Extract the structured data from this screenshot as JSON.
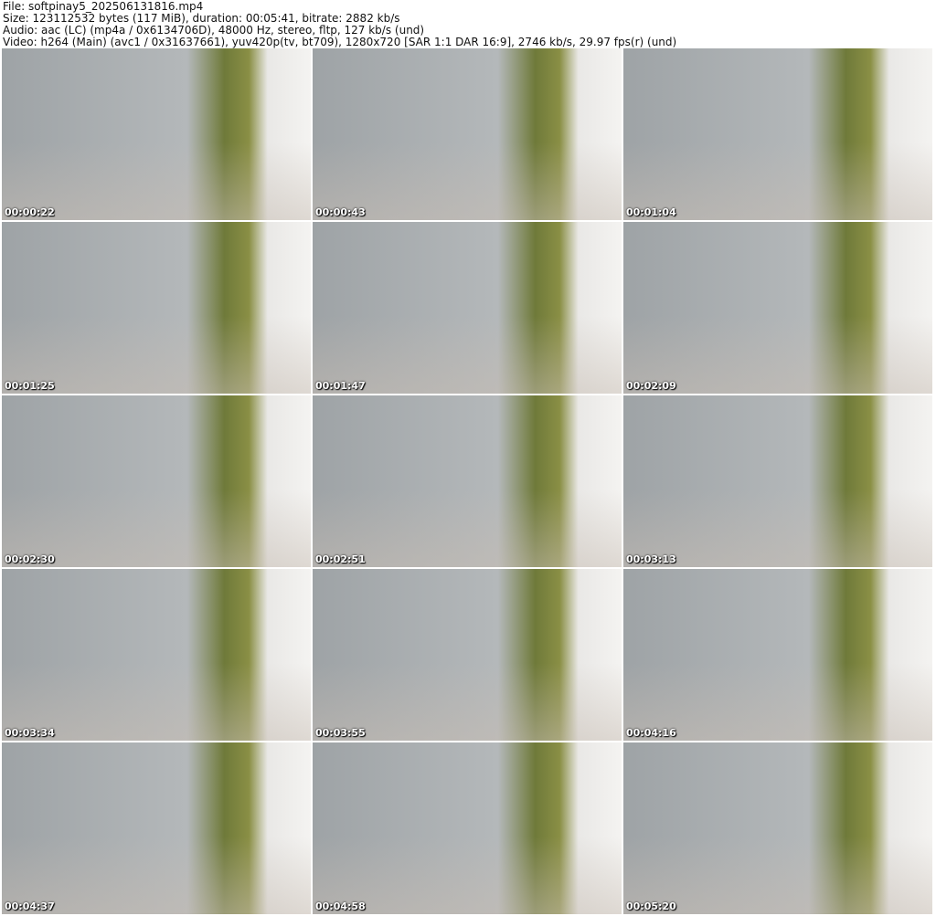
{
  "header": {
    "file": "File: softpinay5_202506131816.mp4",
    "size": "Size: 123112532 bytes (117 MiB), duration: 00:05:41, bitrate: 2882 kb/s",
    "audio": "Audio: aac (LC) (mp4a / 0x6134706D), 48000 Hz, stereo, fltp, 127 kb/s (und)",
    "video": "Video: h264 (Main) (avc1 / 0x31637661), yuv420p(tv, bt709), 1280x720 [SAR 1:1 DAR 16:9], 2746 kb/s, 29.97 fps(r) (und)"
  },
  "frames": [
    {
      "timestamp": "00:00:22"
    },
    {
      "timestamp": "00:00:43"
    },
    {
      "timestamp": "00:01:04"
    },
    {
      "timestamp": "00:01:25"
    },
    {
      "timestamp": "00:01:47"
    },
    {
      "timestamp": "00:02:09"
    },
    {
      "timestamp": "00:02:30"
    },
    {
      "timestamp": "00:02:51"
    },
    {
      "timestamp": "00:03:13"
    },
    {
      "timestamp": "00:03:34"
    },
    {
      "timestamp": "00:03:55"
    },
    {
      "timestamp": "00:04:16"
    },
    {
      "timestamp": "00:04:37"
    },
    {
      "timestamp": "00:04:58"
    },
    {
      "timestamp": "00:05:20"
    }
  ]
}
